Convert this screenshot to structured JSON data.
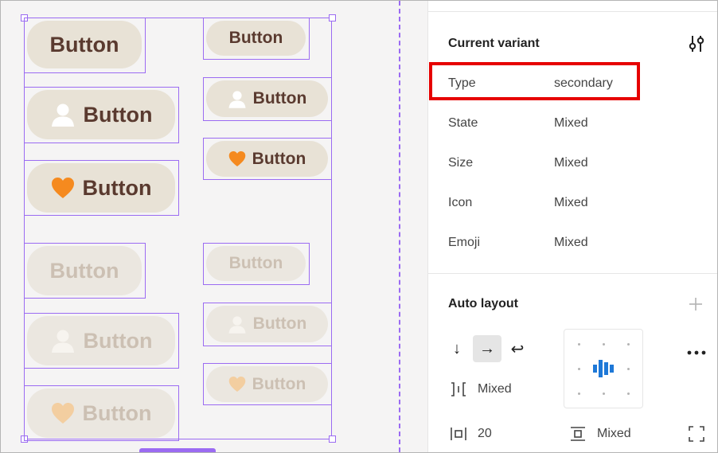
{
  "canvas": {
    "button_label": "Button",
    "primary_buttons": [
      "Button",
      "Button",
      "Button",
      "Button",
      "Button",
      "Button"
    ],
    "disabled_buttons": [
      "Button",
      "Button",
      "Button",
      "Button",
      "Button",
      "Button"
    ]
  },
  "panel": {
    "current_variant": {
      "title": "Current variant",
      "properties": [
        {
          "label": "Type",
          "value": "secondary"
        },
        {
          "label": "State",
          "value": "Mixed"
        },
        {
          "label": "Size",
          "value": "Mixed"
        },
        {
          "label": "Icon",
          "value": "Mixed"
        },
        {
          "label": "Emoji",
          "value": "Mixed"
        }
      ]
    },
    "auto_layout": {
      "title": "Auto layout",
      "directions": [
        "vertical",
        "horizontal",
        "wrap"
      ],
      "active_direction": "horizontal",
      "spacing_between": "Mixed",
      "padding_horizontal": "20",
      "padding_vertical": "Mixed"
    }
  },
  "colors": {
    "selection": "#9b6bf2",
    "button_bg": "#e8e2d6",
    "button_text": "#5a3a2f",
    "disabled_text": "#ccc0b3",
    "highlight": "#e60000",
    "align_accent": "#1e78d7"
  }
}
